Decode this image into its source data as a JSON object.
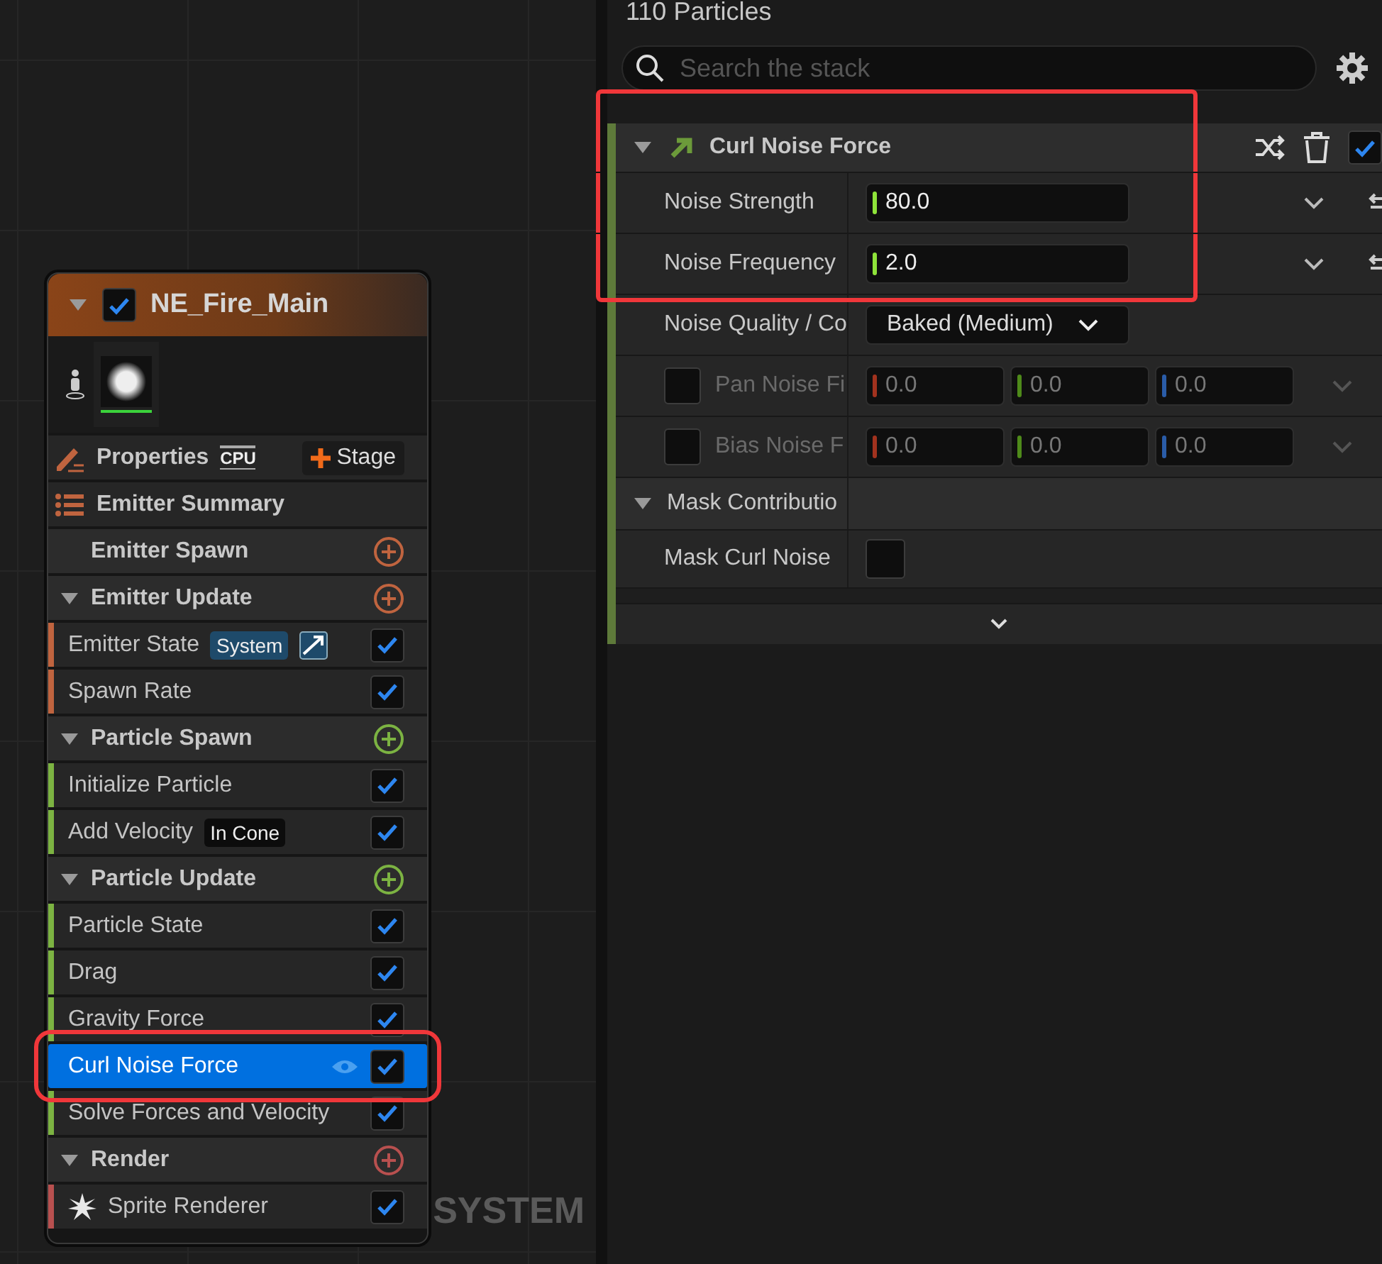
{
  "graph": {
    "watermark": "SYSTEM",
    "node": {
      "title": "NE_Fire_Main",
      "expanded": true,
      "enabled": true,
      "properties": {
        "label": "Properties",
        "sim_target": "CPU",
        "stage_button": "Stage"
      },
      "summary": "Emitter Summary",
      "groups": [
        {
          "title": "Emitter Spawn",
          "color": "#c0643f"
        },
        {
          "title": "Emitter Update",
          "color": "#c0643f",
          "items": [
            {
              "kind": "system",
              "label": "Emitter State",
              "badge": "System",
              "enabled": true,
              "selected": false,
              "highlighted": false
            },
            {
              "kind": "plain",
              "label": "Spawn Rate",
              "enabled": true,
              "selected": false,
              "highlighted": false
            }
          ]
        },
        {
          "title": "Particle Spawn",
          "color": "#7cb342",
          "items": [
            {
              "kind": "plain",
              "label": "Initialize Particle",
              "enabled": true,
              "selected": false,
              "highlighted": false
            },
            {
              "kind": "mode",
              "label": "Add Velocity",
              "badge": "In Cone",
              "enabled": true,
              "selected": false,
              "highlighted": false
            }
          ]
        },
        {
          "title": "Particle Update",
          "color": "#7cb342",
          "items": [
            {
              "kind": "plain",
              "label": "Particle State",
              "enabled": true,
              "selected": false,
              "highlighted": false
            },
            {
              "kind": "plain",
              "label": "Drag",
              "enabled": true,
              "selected": false,
              "highlighted": false
            },
            {
              "kind": "plain",
              "label": "Gravity Force",
              "enabled": true,
              "selected": false,
              "highlighted": false
            },
            {
              "kind": "plain",
              "label": "Curl Noise Force",
              "enabled": true,
              "selected": true,
              "highlighted": true
            },
            {
              "kind": "plain",
              "label": "Solve Forces and Velocity",
              "enabled": true,
              "selected": false,
              "highlighted": false
            }
          ]
        },
        {
          "title": "Render",
          "color": "#b8504f",
          "items": [
            {
              "kind": "renderer",
              "label": "Sprite Renderer",
              "enabled": true,
              "selected": false,
              "highlighted": false
            }
          ]
        }
      ]
    }
  },
  "stack": {
    "particle_count": "110 Particles",
    "search": {
      "placeholder": "Search the stack"
    },
    "module": {
      "title": "Curl Noise Force",
      "expanded": true,
      "enabled": true,
      "highlighted": true,
      "params": [
        {
          "kind": "float",
          "label": "Noise Strength",
          "value": "80.0",
          "highlighted": true
        },
        {
          "kind": "float",
          "label": "Noise Frequency",
          "value": "2.0",
          "highlighted": true
        },
        {
          "kind": "dropdown",
          "label": "Noise Quality / Co",
          "value": "Baked (Medium)",
          "highlighted": false
        },
        {
          "kind": "vector",
          "label": "Pan Noise Fi",
          "checked": false,
          "values": [
            "0.0",
            "0.0",
            "0.0"
          ],
          "highlighted": false
        },
        {
          "kind": "vector",
          "label": "Bias Noise F",
          "checked": false,
          "values": [
            "0.0",
            "0.0",
            "0.0"
          ],
          "highlighted": false
        },
        {
          "kind": "section",
          "label": "Mask Contributio",
          "expanded": true,
          "highlighted": false
        },
        {
          "kind": "bool",
          "label": "Mask Curl Noise",
          "checked": false,
          "highlighted": false
        }
      ]
    }
  }
}
